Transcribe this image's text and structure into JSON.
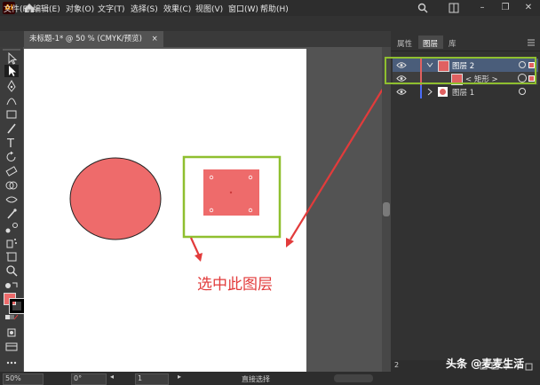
{
  "app": {
    "logo": "Ai"
  },
  "menu": [
    "文件(F)",
    "编辑(E)",
    "对象(O)",
    "文字(T)",
    "选择(S)",
    "效果(C)",
    "视图(V)",
    "窗口(W)",
    "帮助(H)"
  ],
  "window_controls": {
    "minimize": "–",
    "restore": "❐",
    "close": "✕"
  },
  "document_tab": {
    "title": "未标题-1* @ 50 % (CMYK/预览)",
    "close": "×"
  },
  "panel": {
    "tabs": [
      "属性",
      "图层",
      "库"
    ],
    "active_tab": "图层",
    "layers": [
      {
        "name": "图层 2",
        "expanded": true,
        "selected": true,
        "color": "#e06161",
        "kind": "layer"
      },
      {
        "name": "< 矩形 >",
        "selected": true,
        "color": "#e06161",
        "kind": "object"
      },
      {
        "name": "图层 1",
        "expanded": false,
        "selected": false,
        "color": "#4a6cf7",
        "kind": "layer"
      }
    ]
  },
  "annotation": "选中此图层",
  "status": {
    "zoom": "50%",
    "rotation": "0°",
    "artboard": "1",
    "tool": "直接选择"
  },
  "watermark": "头条 @麦麦生活",
  "colors": {
    "shape_fill": "#ee6b6b",
    "highlight": "#8fbf2f",
    "arrow": "#e23b3b",
    "selected_row": "#4a5d7a"
  }
}
